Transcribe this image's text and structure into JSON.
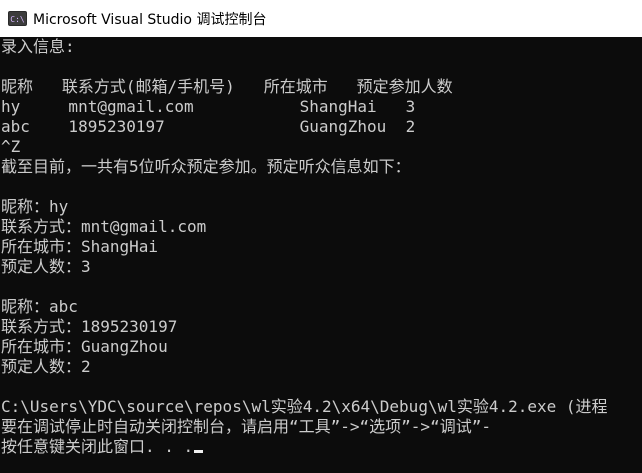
{
  "window": {
    "title": "Microsoft Visual Studio 调试控制台",
    "icon": "console-app-icon",
    "icon_glyph": "C:\\"
  },
  "console": {
    "lines": [
      "录入信息:",
      "",
      "昵称   联系方式(邮箱/手机号)   所在城市   预定参加人数",
      "hy     mnt@gmail.com           ShangHai   3",
      "abc    1895230197              GuangZhou  2",
      "^Z",
      "截至目前，一共有5位听众预定参加。预定听众信息如下：",
      "",
      "昵称：hy",
      "联系方式：mnt@gmail.com",
      "所在城市：ShangHai",
      "预定人数：3",
      "",
      "昵称：abc",
      "联系方式：1895230197",
      "所在城市：GuangZhou",
      "预定人数：2",
      "",
      "C:\\Users\\YDC\\source\\repos\\wl实验4.2\\x64\\Debug\\wl实验4.2.exe (进程",
      "要在调试停止时自动关闭控制台，请启用“工具”->“选项”->“调试”-",
      "按任意键关闭此窗口. . ."
    ]
  },
  "colors": {
    "console_background": "#0c0c0c",
    "console_text": "#cccccc",
    "titlebar_background": "#ffffff"
  }
}
